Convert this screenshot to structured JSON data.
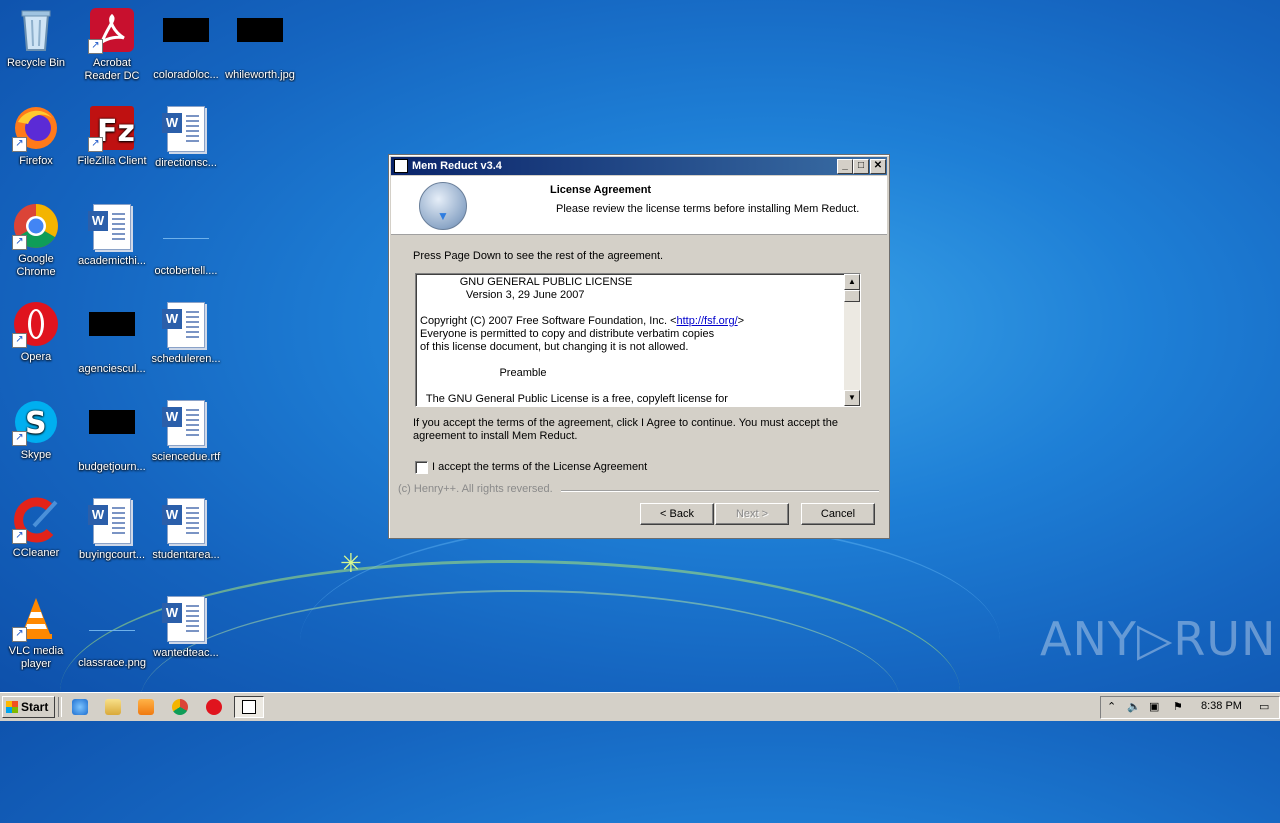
{
  "desktop": {
    "icons": [
      {
        "label": "Recycle Bin",
        "icon": "recycle-bin-icon"
      },
      {
        "label": "Acrobat Reader DC",
        "icon": "acrobat-icon"
      },
      {
        "label": "coloradoloc...",
        "icon": "image-thumbnail-icon"
      },
      {
        "label": "whileworth.jpg",
        "icon": "image-thumbnail-icon"
      },
      {
        "label": "Firefox",
        "icon": "firefox-icon"
      },
      {
        "label": "FileZilla Client",
        "icon": "filezilla-icon"
      },
      {
        "label": "directionsc...",
        "icon": "word-document-icon"
      },
      {
        "label": "Google Chrome",
        "icon": "chrome-icon"
      },
      {
        "label": "academicthi...",
        "icon": "word-document-icon"
      },
      {
        "label": "octobertell....",
        "icon": "image-thumbnail-icon"
      },
      {
        "label": "Opera",
        "icon": "opera-icon"
      },
      {
        "label": "agenciescul...",
        "icon": "image-thumbnail-icon"
      },
      {
        "label": "scheduleren...",
        "icon": "word-document-icon"
      },
      {
        "label": "Skype",
        "icon": "skype-icon"
      },
      {
        "label": "budgetjourn...",
        "icon": "image-thumbnail-icon"
      },
      {
        "label": "sciencedue.rtf",
        "icon": "word-document-icon"
      },
      {
        "label": "CCleaner",
        "icon": "ccleaner-icon"
      },
      {
        "label": "buyingcourt...",
        "icon": "word-document-icon"
      },
      {
        "label": "studentarea...",
        "icon": "word-document-icon"
      },
      {
        "label": "VLC media player",
        "icon": "vlc-icon"
      },
      {
        "label": "classrace.png",
        "icon": "image-thumbnail-icon"
      },
      {
        "label": "wantedteac...",
        "icon": "word-document-icon"
      }
    ]
  },
  "installer": {
    "title": "Mem Reduct v3.4",
    "header_title": "License Agreement",
    "header_subtitle": "Please review the license terms before installing Mem Reduct.",
    "instruction": "Press Page Down to see the rest of the agreement.",
    "license_lines": [
      "             GNU GENERAL PUBLIC LICENSE",
      "               Version 3, 29 June 2007",
      "",
      "Copyright (C) 2007 Free Software Foundation, Inc. <",
      "Everyone is permitted to copy and distribute verbatim copies",
      "of this license document, but changing it is not allowed.",
      "",
      "                          Preamble",
      "",
      "  The GNU General Public License is a free, copyleft license for"
    ],
    "license_link": "http://fsf.org/",
    "license_link_suffix": ">",
    "accept_text": "If you accept the terms of the agreement, click I Agree to continue. You must accept the agreement to install Mem Reduct.",
    "checkbox_label": "I accept the terms of the License Agreement",
    "checkbox_checked": false,
    "copyright": "(c) Henry++. All rights reversed.",
    "buttons": {
      "back": "< Back",
      "next": "Next >",
      "cancel": "Cancel"
    }
  },
  "taskbar": {
    "start_label": "Start",
    "clock": "8:38 PM"
  },
  "watermark": "ANY▷RUN"
}
